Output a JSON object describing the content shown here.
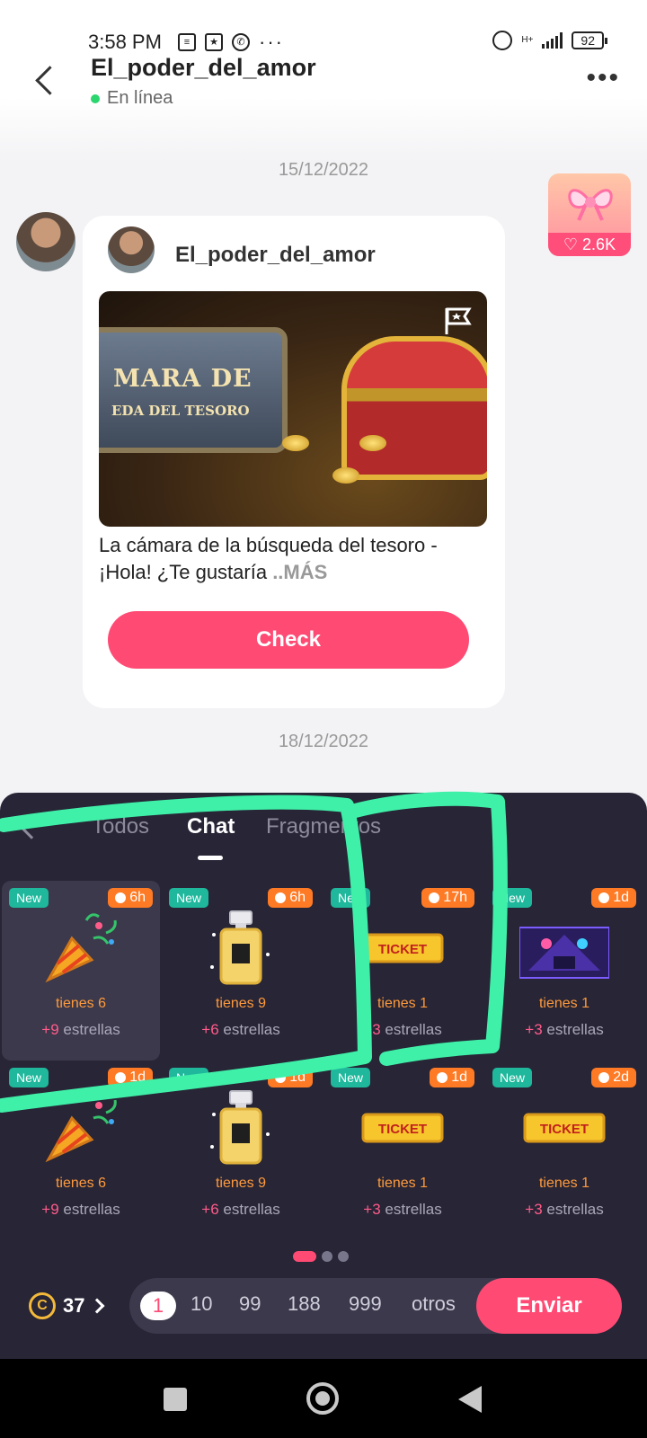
{
  "status": {
    "time": "3:58 PM",
    "network": "H+",
    "battery": "92"
  },
  "header": {
    "title": "El_poder_del_amor",
    "status": "En línea"
  },
  "gift_badge": {
    "count": "2.6K"
  },
  "messages": [
    {
      "date": "15/12/2022"
    },
    {
      "date": "18/12/2022"
    }
  ],
  "card": {
    "sender": "El_poder_del_amor",
    "image_title_line1": "MARA DE",
    "image_title_line2": "EDA DEL TESORO",
    "text": "La cámara de la búsqueda del tesoro - ¡Hola! ¿Te gustaría ",
    "more": "..MÁS",
    "button": "Check"
  },
  "gift_panel": {
    "tabs": [
      "Todos",
      "Chat",
      "Fragmentos"
    ],
    "active_tab": "Chat",
    "gifts": [
      {
        "new": "New",
        "time": "6h",
        "type": "party-popper",
        "qty": "tienes 6",
        "plus": "+9",
        "stars": "estrellas"
      },
      {
        "new": "New",
        "time": "6h",
        "type": "perfume",
        "qty": "tienes 9",
        "plus": "+6",
        "stars": "estrellas"
      },
      {
        "new": "New",
        "time": "17h",
        "type": "ticket",
        "qty": "tienes 1",
        "plus": "+3",
        "stars": "estrellas",
        "ticket_text": "TICKET"
      },
      {
        "new": "New",
        "time": "1d",
        "type": "concert",
        "qty": "tienes 1",
        "plus": "+3",
        "stars": "estrellas"
      },
      {
        "new": "New",
        "time": "1d",
        "type": "party-popper",
        "qty": "tienes 6",
        "plus": "+9",
        "stars": "estrellas"
      },
      {
        "new": "New",
        "time": "1d",
        "type": "perfume",
        "qty": "tienes 9",
        "plus": "+6",
        "stars": "estrellas"
      },
      {
        "new": "New",
        "time": "1d",
        "type": "ticket",
        "qty": "tienes 1",
        "plus": "+3",
        "stars": "estrellas",
        "ticket_text": "TICKET"
      },
      {
        "new": "New",
        "time": "2d",
        "type": "ticket",
        "qty": "tienes 1",
        "plus": "+3",
        "stars": "estrellas",
        "ticket_text": "TICKET"
      }
    ],
    "pages": 3,
    "current_page": 1,
    "coins": "37",
    "coin_symbol": "C",
    "quantities": [
      "1",
      "10",
      "99",
      "188",
      "999",
      "otros"
    ],
    "selected_quantity": "1",
    "send": "Enviar"
  },
  "colors": {
    "accent": "#ff4a74",
    "panel": "#272536",
    "annotation": "#3ff0a8"
  }
}
